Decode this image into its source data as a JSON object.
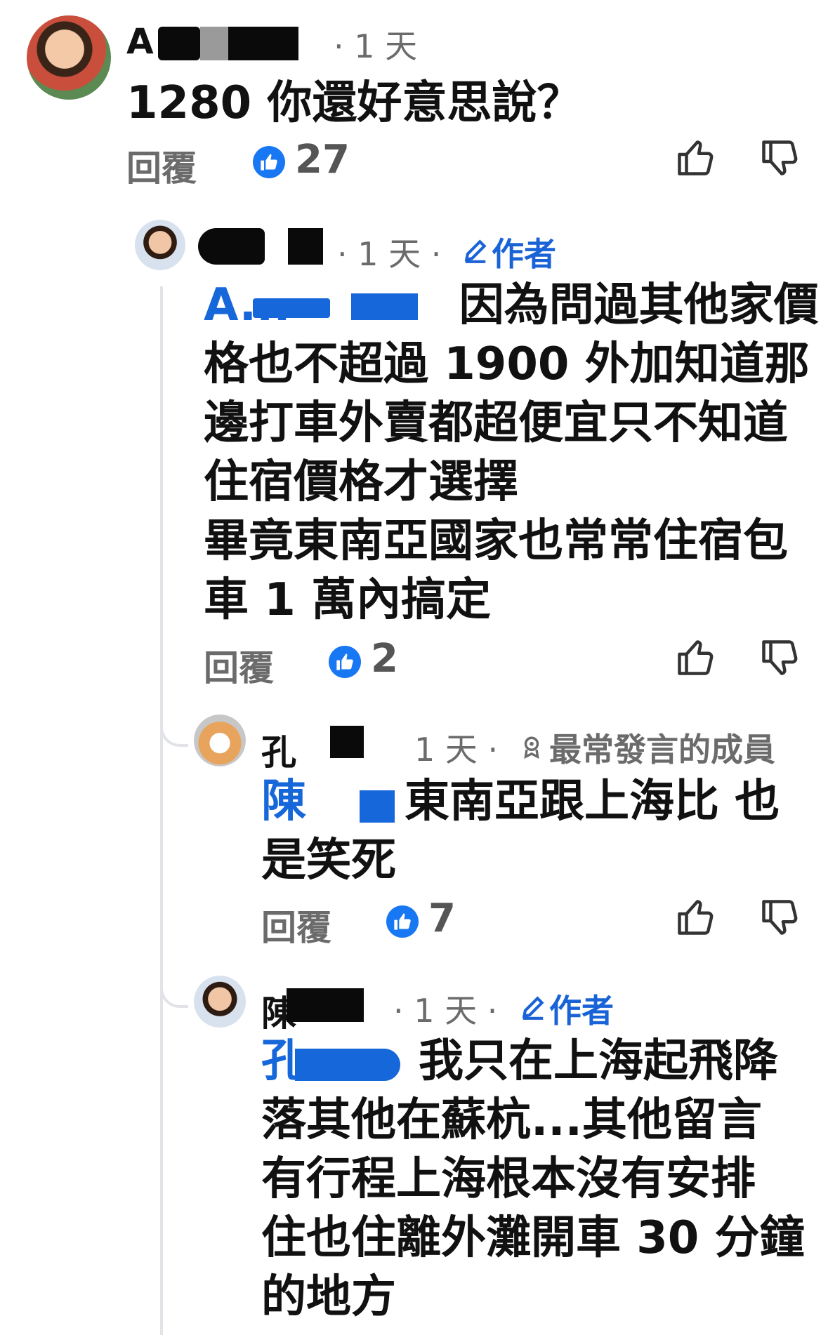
{
  "comments": [
    {
      "author_visible": "A",
      "time": "· 1 天",
      "text": "1280 你還好意思說？",
      "reply_label": "回覆",
      "likes": "27"
    },
    {
      "author_visible": "",
      "time": "· 1 天 ·",
      "badge": "作者",
      "mention": "A...",
      "text": "因為問過其他家價\n格也不超過 1900 外加知道那\n邊打車外賣都超便宜只不知道\n住宿價格才選擇\n畢竟東南亞國家也常常住宿包\n車 1 萬內搞定",
      "reply_label": "回覆",
      "likes": "2"
    },
    {
      "author_visible": "孔",
      "time": "1 天 ·",
      "badge": "最常發言的成員",
      "mention": "陳",
      "text": "東南亞跟上海比 也\n是笑死",
      "reply_label": "回覆",
      "likes": "7"
    },
    {
      "author_visible": "陳",
      "time": "· 1 天 ·",
      "badge": "作者",
      "mention": "孔",
      "text": "我只在上海起飛降\n落其他在蘇杭...其他留言\n有行程上海根本沒有安排\n住也住離外灘開車 30 分鐘\n的地方"
    }
  ],
  "colors": {
    "accent": "#1877f2",
    "mention": "#1667d9",
    "muted": "#6b6b6b"
  }
}
